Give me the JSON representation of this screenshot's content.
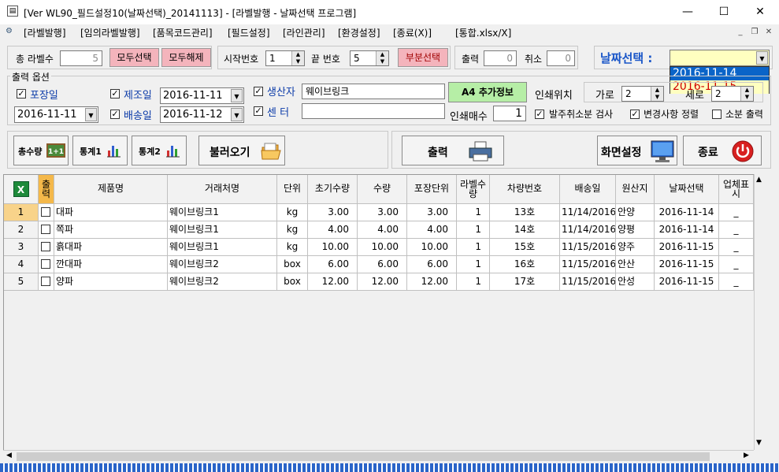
{
  "window": {
    "title": "[Ver WL90_필드설정10(날짜선택)_20141113] - [라벨발행 - 날짜선택 프로그램]",
    "minimize": "—",
    "maximize": "☐",
    "close": "✕"
  },
  "menu": {
    "items": [
      "[라벨발행]",
      "[임의라벨발행]",
      "[품목코드관리]",
      "[필드설정]",
      "[라인관리]",
      "[환경설정]",
      "[종료(X)]",
      "[통합.xlsx/X]"
    ],
    "mdi_min": "_",
    "mdi_restore": "❐",
    "mdi_close": "✕"
  },
  "top": {
    "total_label": "총 라벨수",
    "total_value": "5",
    "select_all": "모두선택",
    "deselect_all": "모두해제",
    "start_label": "시작번호",
    "start_value": "1",
    "end_label": "끝 번호",
    "end_value": "5",
    "partial_select": "부분선택",
    "print_label": "출력",
    "print_value": "0",
    "cancel_label": "취소",
    "cancel_value": "0",
    "date_select_label": "날짜선택 :",
    "date_options": [
      "2016-11-14",
      "2016-11-15"
    ]
  },
  "options": {
    "group_label": "출력 옵션",
    "packdate_label": "포장일",
    "packdate_value": "2016-11-11",
    "mfgdate_label": "제조일",
    "mfgdate_value": "2016-11-11",
    "shipdate_label": "배송일",
    "shipdate_value": "2016-11-12",
    "producer_label": "생산자",
    "producer_value": "웨이브링크",
    "center_label": "센 터",
    "center_value": "",
    "a4_button": "A4 추가정보",
    "print_pos_label": "인쇄위치",
    "horiz_label": "가로",
    "horiz_value": "2",
    "vert_label": "세로",
    "vert_value": "2",
    "copies_label": "인쇄매수",
    "copies_value": "1",
    "check_cancel_order": "발주취소분 검사",
    "check_sort_change": "변경사항 정렬",
    "check_small_print": "소분 출력"
  },
  "toolbar": {
    "total_qty": "총수량",
    "total_qty_badge": "1+1",
    "stats1": "통계1",
    "stats2": "통계2",
    "load": "불러오기",
    "print": "출력",
    "screen_settings": "화면설정",
    "exit": "종료"
  },
  "table": {
    "headers": [
      "출력",
      "제품명",
      "거래처명",
      "단위",
      "초기수량",
      "수량",
      "포장단위",
      "라벨수량",
      "차량번호",
      "배송일",
      "원산지",
      "날짜선택",
      "업체표시"
    ],
    "rows": [
      {
        "no": "1",
        "product": "대파",
        "client": "웨이브링크1",
        "unit": "kg",
        "init_qty": "3.00",
        "qty": "3.00",
        "pack": "3.00",
        "labels": "1",
        "car": "13호",
        "ship": "11/14/2016",
        "origin": "안양",
        "date": "2016-11-14",
        "mark": "_"
      },
      {
        "no": "2",
        "product": "쪽파",
        "client": "웨이브링크1",
        "unit": "kg",
        "init_qty": "4.00",
        "qty": "4.00",
        "pack": "4.00",
        "labels": "1",
        "car": "14호",
        "ship": "11/14/2016",
        "origin": "양평",
        "date": "2016-11-14",
        "mark": "_"
      },
      {
        "no": "3",
        "product": "흙대파",
        "client": "웨이브링크1",
        "unit": "kg",
        "init_qty": "10.00",
        "qty": "10.00",
        "pack": "10.00",
        "labels": "1",
        "car": "15호",
        "ship": "11/15/2016",
        "origin": "양주",
        "date": "2016-11-15",
        "mark": "_"
      },
      {
        "no": "4",
        "product": "깐대파",
        "client": "웨이브링크2",
        "unit": "box",
        "init_qty": "6.00",
        "qty": "6.00",
        "pack": "6.00",
        "labels": "1",
        "car": "16호",
        "ship": "11/15/2016",
        "origin": "안산",
        "date": "2016-11-15",
        "mark": "_"
      },
      {
        "no": "5",
        "product": "양파",
        "client": "웨이브링크2",
        "unit": "box",
        "init_qty": "12.00",
        "qty": "12.00",
        "pack": "12.00",
        "labels": "1",
        "car": "17호",
        "ship": "11/15/2016",
        "origin": "안성",
        "date": "2016-11-15",
        "mark": "_"
      }
    ]
  },
  "colors": {
    "pink_button": "#f4b4bc",
    "a4_green": "#b6eea6",
    "date_highlight": "#ffffc0",
    "dropdown_selected": "#0a64c8",
    "dropdown_red_text": "#d00000"
  }
}
